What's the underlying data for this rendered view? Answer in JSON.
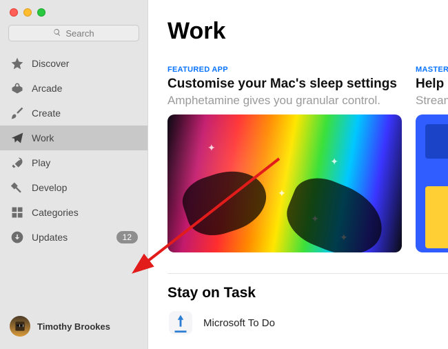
{
  "search": {
    "placeholder": "Search"
  },
  "sidebar": {
    "items": [
      {
        "label": "Discover"
      },
      {
        "label": "Arcade"
      },
      {
        "label": "Create"
      },
      {
        "label": "Work"
      },
      {
        "label": "Play"
      },
      {
        "label": "Develop"
      },
      {
        "label": "Categories"
      },
      {
        "label": "Updates",
        "badge": "12"
      }
    ]
  },
  "user": {
    "name": "Timothy Brookes"
  },
  "page": {
    "title": "Work"
  },
  "cards": [
    {
      "eyebrow": "FEATURED APP",
      "headline": "Customise your Mac's sleep settings",
      "sub": "Amphetamine gives you granular control."
    },
    {
      "eyebrow": "MASTER YO",
      "headline": "Help Ma",
      "sub": "Streamli"
    }
  ],
  "section": {
    "title": "Stay on Task",
    "app1": {
      "name": "Microsoft To Do"
    }
  }
}
